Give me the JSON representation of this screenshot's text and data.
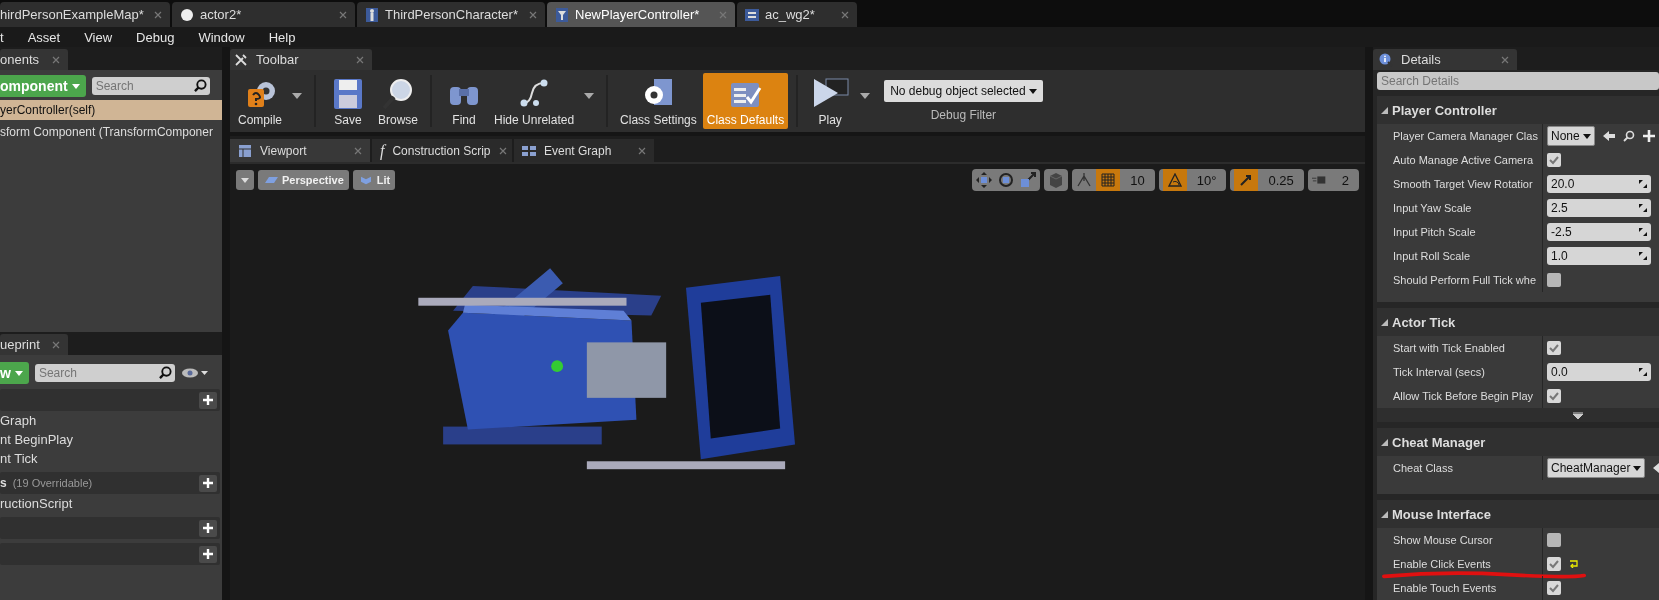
{
  "document_tabs": [
    {
      "label": "hirdPersonExampleMap*",
      "kind": "map",
      "selected": false
    },
    {
      "label": "actor2*",
      "kind": "sphere",
      "selected": false
    },
    {
      "label": "ThirdPersonCharacter*",
      "kind": "character",
      "selected": false
    },
    {
      "label": "NewPlayerController*",
      "kind": "controller",
      "selected": true
    },
    {
      "label": "ac_wg2*",
      "kind": "widget",
      "selected": false
    }
  ],
  "menu": [
    "t",
    "Asset",
    "View",
    "Debug",
    "Window",
    "Help"
  ],
  "components_panel": {
    "tab": "onents",
    "add_button": "omponent",
    "search": {
      "placeholder": "Search"
    },
    "items": [
      {
        "label": "yerController(self)",
        "selected": true
      },
      {
        "label": "sform Component (TransformComponer",
        "selected": false
      }
    ]
  },
  "my_blueprint_panel": {
    "tab": "ueprint",
    "add_button": "w",
    "search": {
      "placeholder": "Search"
    },
    "sections": [
      {
        "kind": "group",
        "items": [
          "Graph",
          "nt BeginPlay",
          "nt Tick"
        ]
      },
      {
        "kind": "group",
        "title": "s",
        "note": "(19 Overridable)",
        "items": [
          "ructionScript"
        ]
      },
      {
        "kind": "header"
      },
      {
        "kind": "header"
      }
    ]
  },
  "toolbar": {
    "tab": "Toolbar",
    "buttons": [
      {
        "label": "Compile",
        "kind": "compile",
        "dropdown": true,
        "selected": false
      },
      {
        "label": "Save",
        "kind": "save",
        "dropdown": false,
        "selected": false
      },
      {
        "label": "Browse",
        "kind": "browse",
        "dropdown": false,
        "selected": false
      },
      {
        "label": "Find",
        "kind": "find",
        "dropdown": false,
        "selected": false
      },
      {
        "label": "Hide Unrelated",
        "kind": "hide_unrelated",
        "dropdown": true,
        "selected": false
      },
      {
        "label": "Class Settings",
        "kind": "class_settings",
        "dropdown": false,
        "selected": false
      },
      {
        "label": "Class Defaults",
        "kind": "class_defaults",
        "dropdown": false,
        "selected": true
      },
      {
        "label": "Play",
        "kind": "play",
        "dropdown": true,
        "selected": false
      }
    ],
    "debug_filter": {
      "value": "No debug object selected",
      "label": "Debug Filter"
    }
  },
  "editor_tabs": [
    {
      "label": "Viewport",
      "kind": "viewport",
      "selected": true
    },
    {
      "label": "Construction Scrip",
      "kind": "function",
      "icon": "f",
      "selected": false
    },
    {
      "label": "Event Graph",
      "kind": "graph",
      "selected": false
    }
  ],
  "viewport": {
    "view_mode": "Perspective",
    "lighting": "Lit",
    "snaps": [
      {
        "kind": "grid",
        "value": "10",
        "on": true
      },
      {
        "kind": "rotation",
        "value": "10°",
        "on": true
      },
      {
        "kind": "scale",
        "value": "0.25",
        "on": true
      }
    ],
    "camera_speed": "2"
  },
  "details": {
    "tab": "Details",
    "search": {
      "placeholder": "Search Details"
    },
    "categories": [
      {
        "title": "Player Controller",
        "rows": [
          {
            "label": "Player Camera Manager Clas",
            "kind": "class",
            "value": "None"
          },
          {
            "label": "Auto Manage Active Camera",
            "kind": "checkbox",
            "checked": true
          },
          {
            "label": "Smooth Target View Rotatior",
            "kind": "number",
            "value": "20.0"
          },
          {
            "label": "Input Yaw Scale",
            "kind": "number",
            "value": "2.5"
          },
          {
            "label": "Input Pitch Scale",
            "kind": "number",
            "value": "-2.5"
          },
          {
            "label": "Input Roll Scale",
            "kind": "number",
            "value": "1.0"
          },
          {
            "label": "Should Perform Full Tick whe",
            "kind": "checkbox",
            "checked": false
          }
        ],
        "advanced": false
      },
      {
        "title": "Actor Tick",
        "rows": [
          {
            "label": "Start with Tick Enabled",
            "kind": "checkbox",
            "checked": true
          },
          {
            "label": "Tick Interval (secs)",
            "kind": "number",
            "value": "0.0"
          },
          {
            "label": "Allow Tick Before Begin Play",
            "kind": "checkbox",
            "checked": true
          }
        ],
        "advanced": true
      },
      {
        "title": "Cheat Manager",
        "rows": [
          {
            "label": "Cheat Class",
            "kind": "class",
            "value": "CheatManager"
          }
        ],
        "advanced": false
      },
      {
        "title": "Mouse Interface",
        "rows": [
          {
            "label": "Show Mouse Cursor",
            "kind": "checkbox",
            "checked": false
          },
          {
            "label": "Enable Click Events",
            "kind": "checkbox",
            "checked": true,
            "modified": true
          },
          {
            "label": "Enable Touch Events",
            "kind": "checkbox",
            "checked": true
          }
        ],
        "advanced": false
      }
    ]
  }
}
